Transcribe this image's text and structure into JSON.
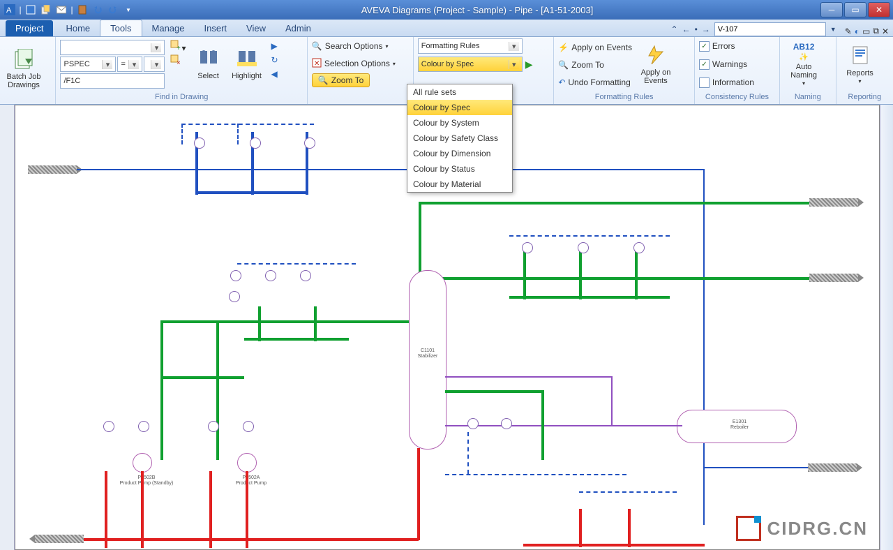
{
  "title": "AVEVA Diagrams (Project - Sample) - Pipe - [A1-51-2003]",
  "menu": {
    "file": "Project",
    "tabs": [
      "Home",
      "Tools",
      "Manage",
      "Insert",
      "View",
      "Admin"
    ],
    "active": "Tools",
    "nav_value": "V-107"
  },
  "ribbon": {
    "batch": {
      "label": "Batch Job Drawings",
      "group": ""
    },
    "find": {
      "group": "Find in Drawing",
      "combo1": "",
      "combo2": "PSPEC",
      "op": "=",
      "val": "",
      "path": "/F1C",
      "select": "Select",
      "highlight": "Highlight"
    },
    "opts": {
      "search": "Search Options",
      "selection": "Selection Options",
      "zoom": "Zoom To"
    },
    "rules": {
      "group": "Formatting Rules",
      "combo1": "Formatting Rules",
      "combo2": "Colour by Spec",
      "apply_events": "Apply on Events",
      "zoom_to": "Zoom To",
      "undo": "Undo Formatting",
      "big": "Apply on Events"
    },
    "consist": {
      "group": "Consistency Rules",
      "errors": "Errors",
      "warnings": "Warnings",
      "info": "Information"
    },
    "naming": {
      "group": "Naming",
      "label": "Auto Naming",
      "ab": "AB12"
    },
    "reporting": {
      "group": "Reporting",
      "label": "Reports"
    }
  },
  "dropdown": {
    "items": [
      "All rule sets",
      "Colour by Spec",
      "Colour by System",
      "Colour by Safety Class",
      "Colour by Dimension",
      "Colour by Status",
      "Colour by Material"
    ],
    "selected": "Colour by Spec"
  },
  "equipment": {
    "stabilizer": {
      "tag": "C1101",
      "name": "Stabilizer"
    },
    "reboiler": {
      "tag": "E1301",
      "name": "Reboiler"
    },
    "pumpA": {
      "tag": "P1502A",
      "name": "Product Pump"
    },
    "pumpB": {
      "tag": "P1502B",
      "name": "Product Pump (Standby)"
    }
  },
  "watermark": "CIDRG.CN",
  "colors": {
    "accent": "#1c5fb0",
    "highlight": "#ffd23a",
    "pipe_blue": "#2050c0",
    "pipe_green": "#10a030",
    "pipe_red": "#e02020",
    "pipe_purple": "#9050c0"
  }
}
